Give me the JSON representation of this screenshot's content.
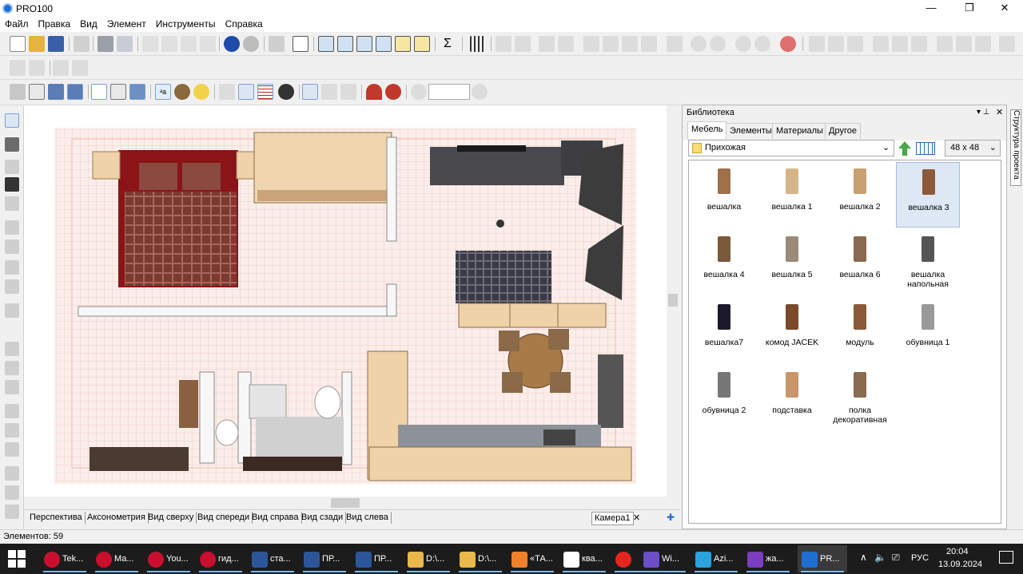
{
  "window": {
    "title": "PRO100",
    "controls": [
      "—",
      "❐",
      "✕"
    ]
  },
  "menu": [
    "Файл",
    "Правка",
    "Вид",
    "Элемент",
    "Инструменты",
    "Справка"
  ],
  "viewtabs": [
    "Перспектива",
    "Аксонометрия",
    "Вид сверху",
    "Вид спереди",
    "Вид справа",
    "Вид сзади",
    "Вид слева"
  ],
  "camera_tab": "Камера1",
  "status": "Элементов: 59",
  "library": {
    "title": "Библиотека",
    "tabs": [
      "Мебель",
      "Элементы",
      "Материалы",
      "Другое"
    ],
    "active_tab": "Мебель",
    "folder": "Прихожая",
    "thumb_size": "48 x  48",
    "items": [
      {
        "label": "вешалка"
      },
      {
        "label": "вешалка 1"
      },
      {
        "label": "вешалка 2"
      },
      {
        "label": "вешалка 3",
        "selected": true
      },
      {
        "label": "вешалка 4"
      },
      {
        "label": "вешалка 5"
      },
      {
        "label": "вешалка 6"
      },
      {
        "label": "вешалка напольная"
      },
      {
        "label": "вешалка7"
      },
      {
        "label": "комод JACEK"
      },
      {
        "label": "модуль"
      },
      {
        "label": "обувница 1"
      },
      {
        "label": "обувница 2"
      },
      {
        "label": "подставка"
      },
      {
        "label": "полка декоративная"
      }
    ]
  },
  "side_tab": "Структура проекта",
  "taskbar": {
    "apps": [
      {
        "label": "Tek...",
        "color": "#c8102e"
      },
      {
        "label": "Ма...",
        "color": "#c8102e"
      },
      {
        "label": "You...",
        "color": "#c8102e"
      },
      {
        "label": "гид...",
        "color": "#c8102e"
      },
      {
        "label": "ста...",
        "color": "#2b579a"
      },
      {
        "label": "ПР...",
        "color": "#2b579a"
      },
      {
        "label": "ПР...",
        "color": "#2b579a"
      },
      {
        "label": "D:\\...",
        "color": "#e8b84b"
      },
      {
        "label": "D:\\...",
        "color": "#e8b84b"
      },
      {
        "label": "«ТА...",
        "color": "#f0812a"
      },
      {
        "label": "ква...",
        "color": "#ffffff"
      },
      {
        "label": "",
        "color": "#e52620"
      },
      {
        "label": "Wi...",
        "color": "#6a4fc9"
      },
      {
        "label": "Azi...",
        "color": "#2aa3de"
      },
      {
        "label": "жа...",
        "color": "#7a3ec0"
      },
      {
        "label": "PR...",
        "color": "#1f6fd0",
        "active": true
      }
    ],
    "lang": "РУС",
    "time": "20:04",
    "date": "13.09.2024"
  }
}
